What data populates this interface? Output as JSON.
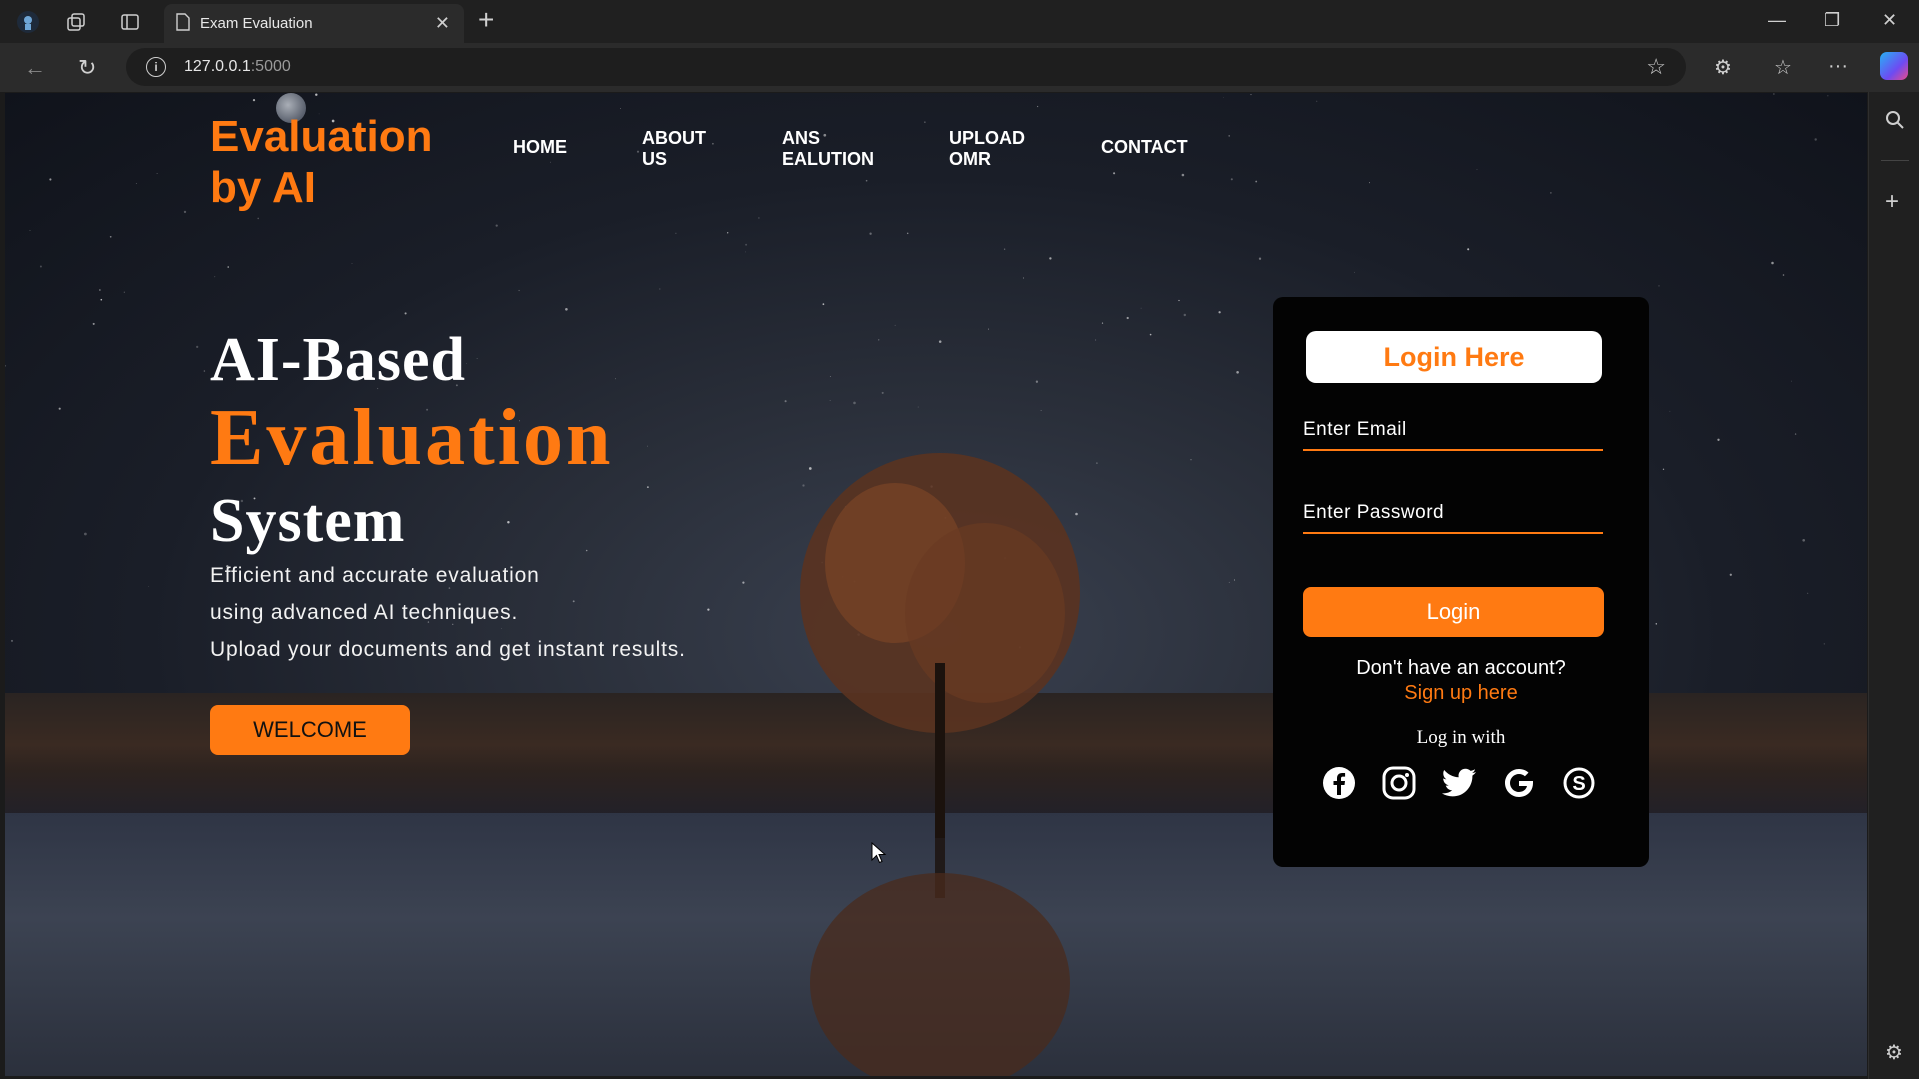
{
  "browser": {
    "tab_title": "Exam Evaluation",
    "url_host": "127.0.0.1",
    "url_port": ":5000"
  },
  "site": {
    "brand_line1": "Evaluation",
    "brand_line2": "by AI",
    "nav": [
      {
        "line1": "HOME",
        "line2": ""
      },
      {
        "line1": "ABOUT",
        "line2": "US"
      },
      {
        "line1": "ANS",
        "line2": "EALUTION"
      },
      {
        "line1": "UPLOAD",
        "line2": "OMR"
      },
      {
        "line1": "CONTACT",
        "line2": ""
      }
    ]
  },
  "hero": {
    "line1": "AI-Based",
    "line2": "Evaluation",
    "line3": "System",
    "desc": [
      "Efficient and accurate evaluation",
      "using advanced AI techniques.",
      "Upload your documents and get instant results."
    ],
    "welcome_label": "WELCOME"
  },
  "login": {
    "title": "Login Here",
    "email_placeholder": "Enter Email",
    "password_placeholder": "Enter Password",
    "login_label": "Login",
    "no_account": "Don't have an account?",
    "signup_label": "Sign up here",
    "login_with": "Log in with",
    "social": [
      "facebook-icon",
      "instagram-icon",
      "twitter-icon",
      "google-icon",
      "skype-icon"
    ]
  },
  "colors": {
    "accent": "#ff7a12",
    "card": "#030303"
  }
}
